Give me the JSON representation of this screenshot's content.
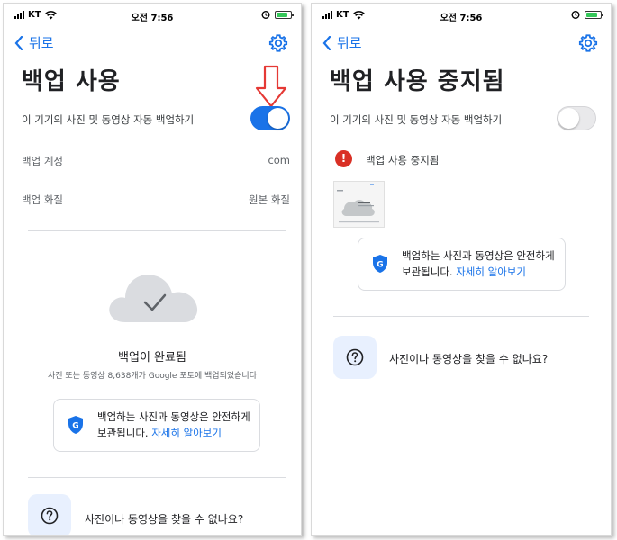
{
  "status": {
    "carrier": "KT",
    "time": "오전 7:56"
  },
  "left": {
    "back_label": "뒤로",
    "title": "백업 사용",
    "auto_backup_label": "이 기기의 사진 및 동영상 자동 백업하기",
    "account_label": "백업 계정",
    "account_value": "com",
    "quality_label": "백업 화질",
    "quality_value": "원본 화질",
    "complete_title": "백업이 완료됨",
    "complete_subtitle": "사진 또는 동영상 8,638개가 Google 포토에 백업되었습니다",
    "secure_text_line1": "백업하는 사진과 동영상은 안전하게",
    "secure_text_line2": "보관됩니다. ",
    "learn_more": "자세히 알아보기",
    "help_text": "사진이나 동영상을 찾을 수 없나요?"
  },
  "right": {
    "back_label": "뒤로",
    "title": "백업 사용 중지됨",
    "auto_backup_label": "이 기기의 사진 및 동영상 자동 백업하기",
    "stopped_label": "백업 사용 중지됨",
    "secure_text_line1": "백업하는 사진과 동영상은 안전하게",
    "secure_text_line2": "보관됩니다. ",
    "learn_more": "자세히 알아보기",
    "help_text": "사진이나 동영상을 찾을 수 없나요?"
  },
  "colors": {
    "accent": "#1a73e8",
    "annotation_arrow": "#e53935",
    "error": "#d93025",
    "toggle_off": "#e9e9eb"
  },
  "toggles": {
    "left_auto_backup": "on",
    "right_auto_backup": "off"
  }
}
